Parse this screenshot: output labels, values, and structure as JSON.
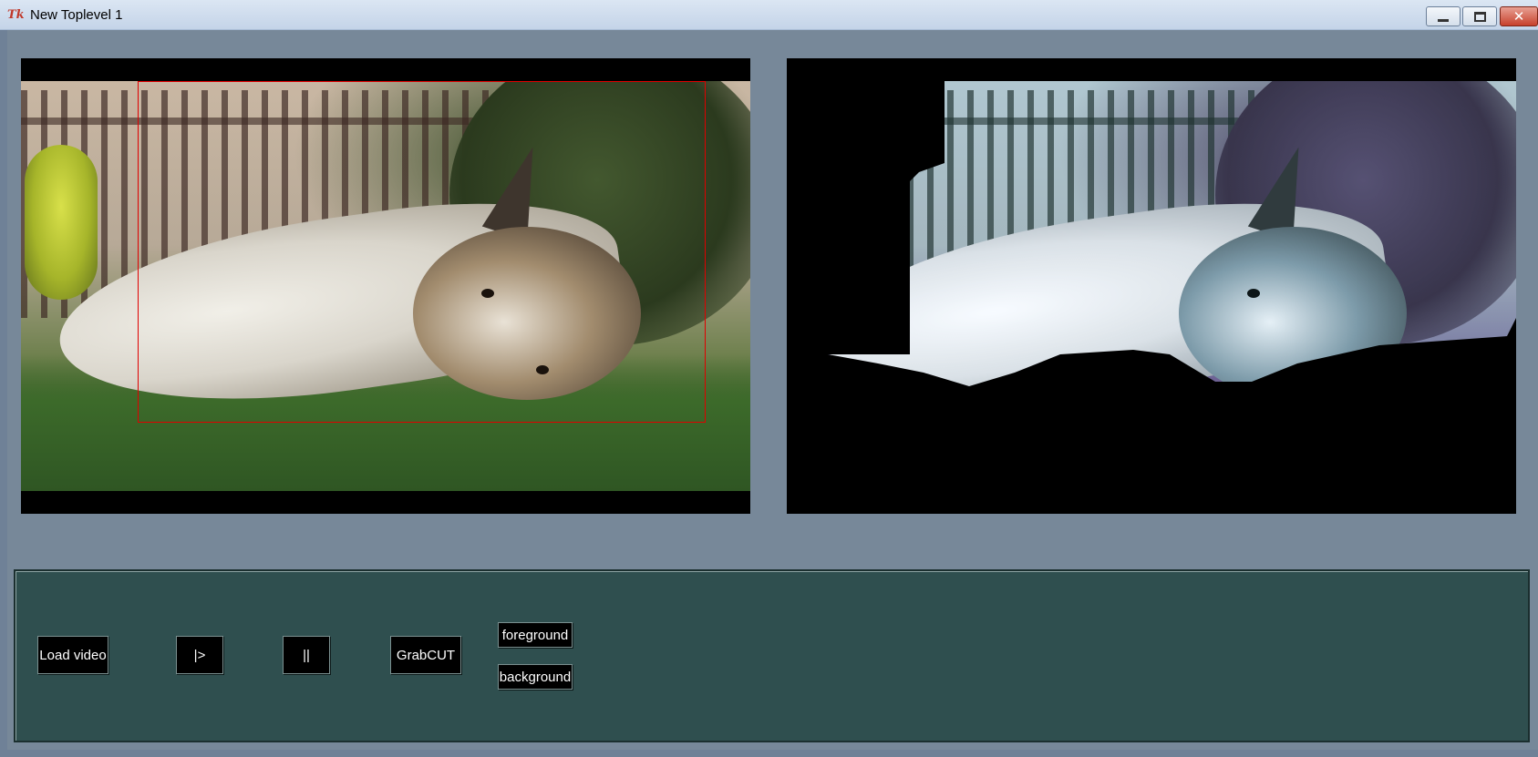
{
  "window": {
    "title": "New Toplevel 1",
    "logo_text": "Tk",
    "minimize_glyph": "",
    "maximize_glyph": "",
    "close_glyph": "✕"
  },
  "controls": {
    "load_video": "Load video",
    "play": "|>",
    "pause": "||",
    "grabcut": "GrabCUT",
    "foreground": "foreground",
    "background": "background"
  },
  "colors": {
    "client_bg": "#778899",
    "control_frame_bg": "#2f4f4f",
    "button_bg": "#000000",
    "button_text": "#ffffff",
    "roi_rect": "#e00000"
  }
}
